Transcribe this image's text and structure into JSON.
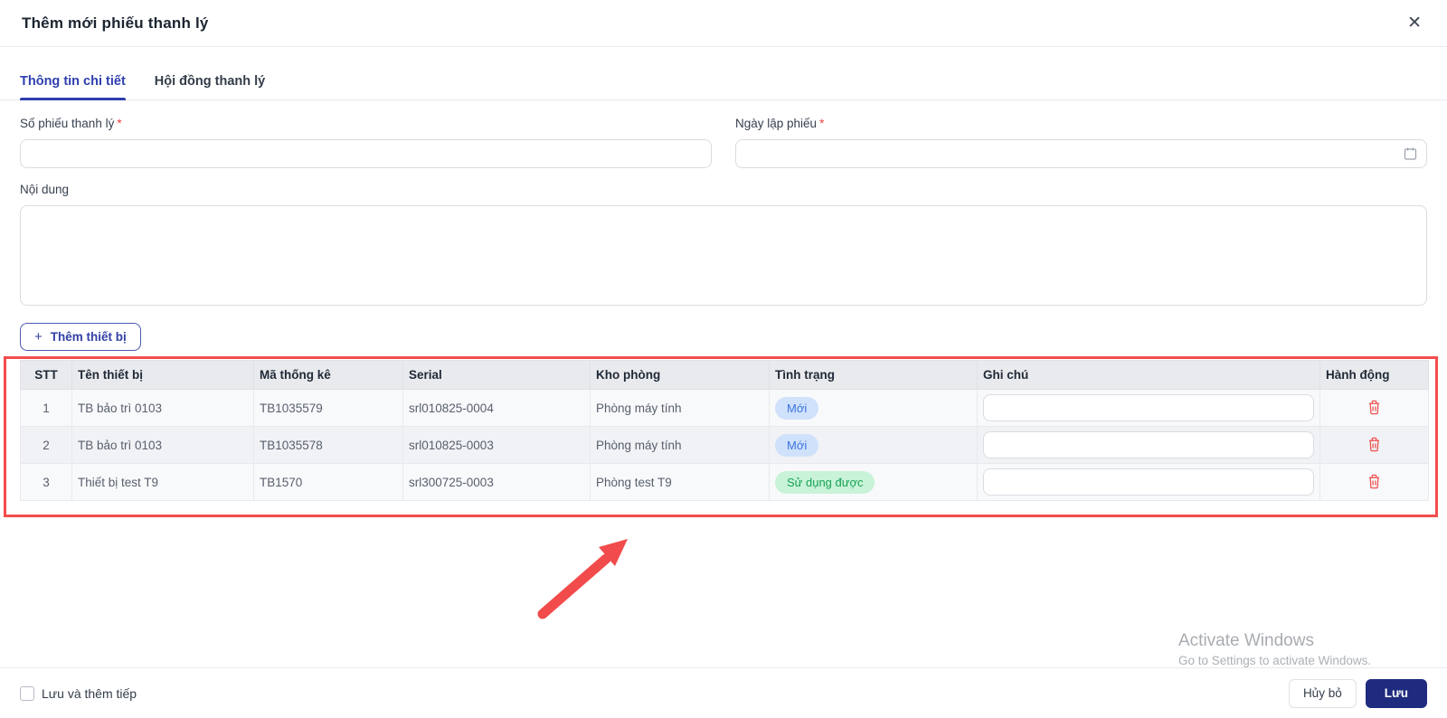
{
  "modal": {
    "title": "Thêm mới phiếu thanh lý",
    "close_glyph": "✕"
  },
  "tabs": [
    {
      "label": "Thông tin chi tiết"
    },
    {
      "label": "Hội đồng thanh lý"
    }
  ],
  "form": {
    "required_mark": "*",
    "so_phieu": {
      "label": "Số phiếu thanh lý",
      "value": ""
    },
    "ngay_lap": {
      "label": "Ngày lập phiếu",
      "value": ""
    },
    "noi_dung": {
      "label": "Nội dung",
      "value": ""
    }
  },
  "add_device": {
    "plus": "+",
    "label": "Thêm thiết bị"
  },
  "table": {
    "headers": [
      "STT",
      "Tên thiết bị",
      "Mã thống kê",
      "Serial",
      "Kho phòng",
      "Tình trạng",
      "Ghi chú",
      "Hành động"
    ],
    "rows": [
      {
        "stt": "1",
        "ten": "TB bảo trì 0103",
        "ma": "TB1035579",
        "serial": "srl010825-0004",
        "kho": "Phòng máy tính",
        "tinh_trang": "Mới",
        "ghi_chu": ""
      },
      {
        "stt": "2",
        "ten": "TB bảo trì 0103",
        "ma": "TB1035578",
        "serial": "srl010825-0003",
        "kho": "Phòng máy tính",
        "tinh_trang": "Mới",
        "ghi_chu": ""
      },
      {
        "stt": "3",
        "ten": "Thiết bị test T9",
        "ma": "TB1570",
        "serial": "srl300725-0003",
        "kho": "Phòng test T9",
        "tinh_trang": "Sử dụng được",
        "ghi_chu": ""
      }
    ]
  },
  "footer": {
    "checkbox_label": "Lưu và thêm tiếp",
    "cancel_label": "Hủy bỏ",
    "save_label": "Lưu"
  },
  "watermark": {
    "line1": "Activate Windows",
    "line2": "Go to Settings to activate Windows."
  },
  "colors": {
    "primary": "#2e3eae",
    "save_button": "#1f2b7e",
    "annotation_red": "#f44d4d",
    "danger": "#ef4444",
    "badge_blue_bg": "#cfe1fb",
    "badge_blue_text": "#3b74e0",
    "badge_green_bg": "#c9f3d8",
    "badge_green_text": "#17a254"
  }
}
